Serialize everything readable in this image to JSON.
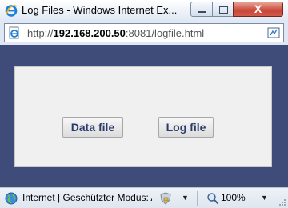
{
  "window": {
    "title": "Log Files - Windows Internet Ex...",
    "close_glyph": "X"
  },
  "address_bar": {
    "url_scheme": "http://",
    "url_host": "192.168.200.50",
    "url_rest": ":8081/logfile.html",
    "icons": {
      "page": "ie-page-icon",
      "compat": "compatibility-view-icon"
    }
  },
  "content": {
    "buttons": {
      "data_file": "Data file",
      "log_file": "Log file"
    }
  },
  "status_bar": {
    "zone_text": "Internet | Geschützter Modus: Aktiv",
    "zoom_text": "100%",
    "icons": {
      "zone": "globe-icon",
      "protected_mode": "shield-lock-icon",
      "zoom": "magnifier-icon"
    }
  },
  "colors": {
    "frame_background": "#3f4c7a",
    "panel_background": "#f0f0f0",
    "button_text": "#2a3b6b",
    "close_button": "#c8473a"
  }
}
